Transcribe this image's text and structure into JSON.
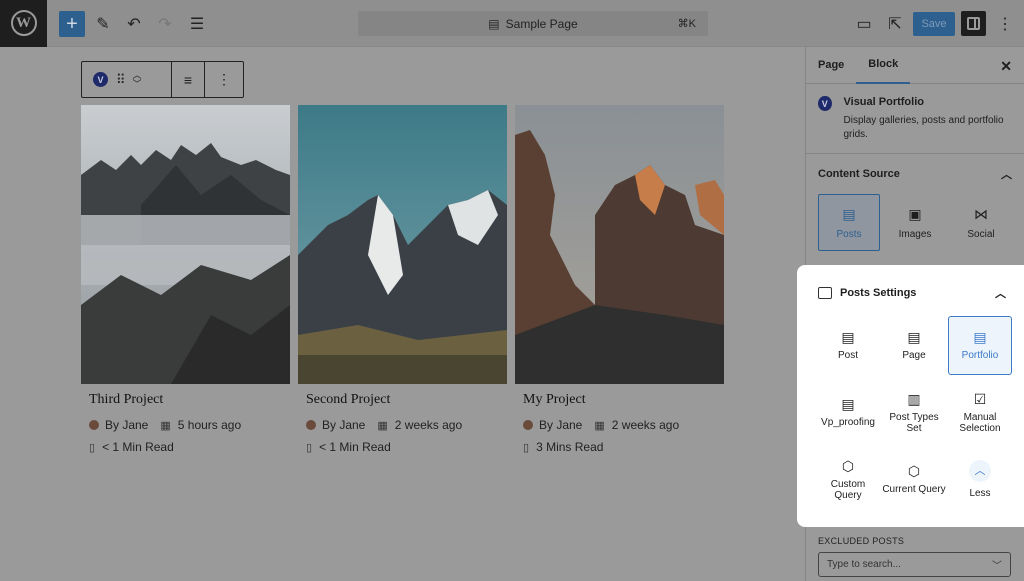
{
  "topbar": {
    "logo": "W",
    "add_icon": "+",
    "doc_title": "Sample Page",
    "shortcut": "⌘K",
    "save_label": "Save"
  },
  "toolbar_block": {
    "badge": "V"
  },
  "cards": [
    {
      "title": "Third Project",
      "author": "By Jane",
      "time": "5 hours ago",
      "read": "< 1 Min Read"
    },
    {
      "title": "Second Project",
      "author": "By Jane",
      "time": "2 weeks ago",
      "read": "< 1 Min Read"
    },
    {
      "title": "My Project",
      "author": "By Jane",
      "time": "2 weeks ago",
      "read": "3 Mins Read"
    }
  ],
  "sidebar": {
    "tabs": [
      "Page",
      "Block"
    ],
    "block_name": "Visual Portfolio",
    "block_desc": "Display galleries, posts and portfolio grids.",
    "content_source": {
      "title": "Content Source",
      "items": [
        "Posts",
        "Images",
        "Social"
      ]
    },
    "posts_settings": {
      "title": "Posts Settings",
      "items": [
        "Post",
        "Page",
        "Portfolio",
        "Vp_proofing",
        "Post Types Set",
        "Manual Selection",
        "Custom Query",
        "Current Query",
        "Less"
      ]
    },
    "excluded_label": "EXCLUDED POSTS",
    "search_placeholder": "Type to search..."
  },
  "colors": {
    "accent": "#3b7bc8",
    "wp_blue": "#2d5f8f"
  }
}
